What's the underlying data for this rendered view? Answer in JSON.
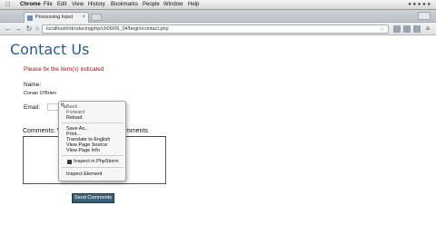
{
  "menubar": {
    "items": [
      "Chrome",
      "File",
      "Edit",
      "View",
      "History",
      "Bookmarks",
      "People",
      "Window",
      "Help"
    ]
  },
  "browser": {
    "tab_title": "Processing Input",
    "url": "localhost/introducingphp/ch06/06_04/begin/contact.php"
  },
  "page": {
    "title": "Contact Us",
    "error": "Please fix the item(s) indicated",
    "name_label": "Name:",
    "name_value": "Conan O'Brien",
    "email_label": "Email:",
    "comments_label_left": "Comments: V",
    "comments_label_right": "mments",
    "submit_label": "Send Comments"
  },
  "context_menu": {
    "group1": [
      "Back",
      "Forward",
      "Reload"
    ],
    "group2": [
      "Save As...",
      "Print...",
      "Translate to English",
      "View Page Source",
      "View Page Info"
    ],
    "group3": [
      "Inspect in PhpStorm"
    ],
    "group4": [
      "Inspect Element"
    ]
  },
  "colors": {
    "title": "#2a5b8a",
    "error": "#8b1a1a",
    "button": "#3b5f78"
  }
}
